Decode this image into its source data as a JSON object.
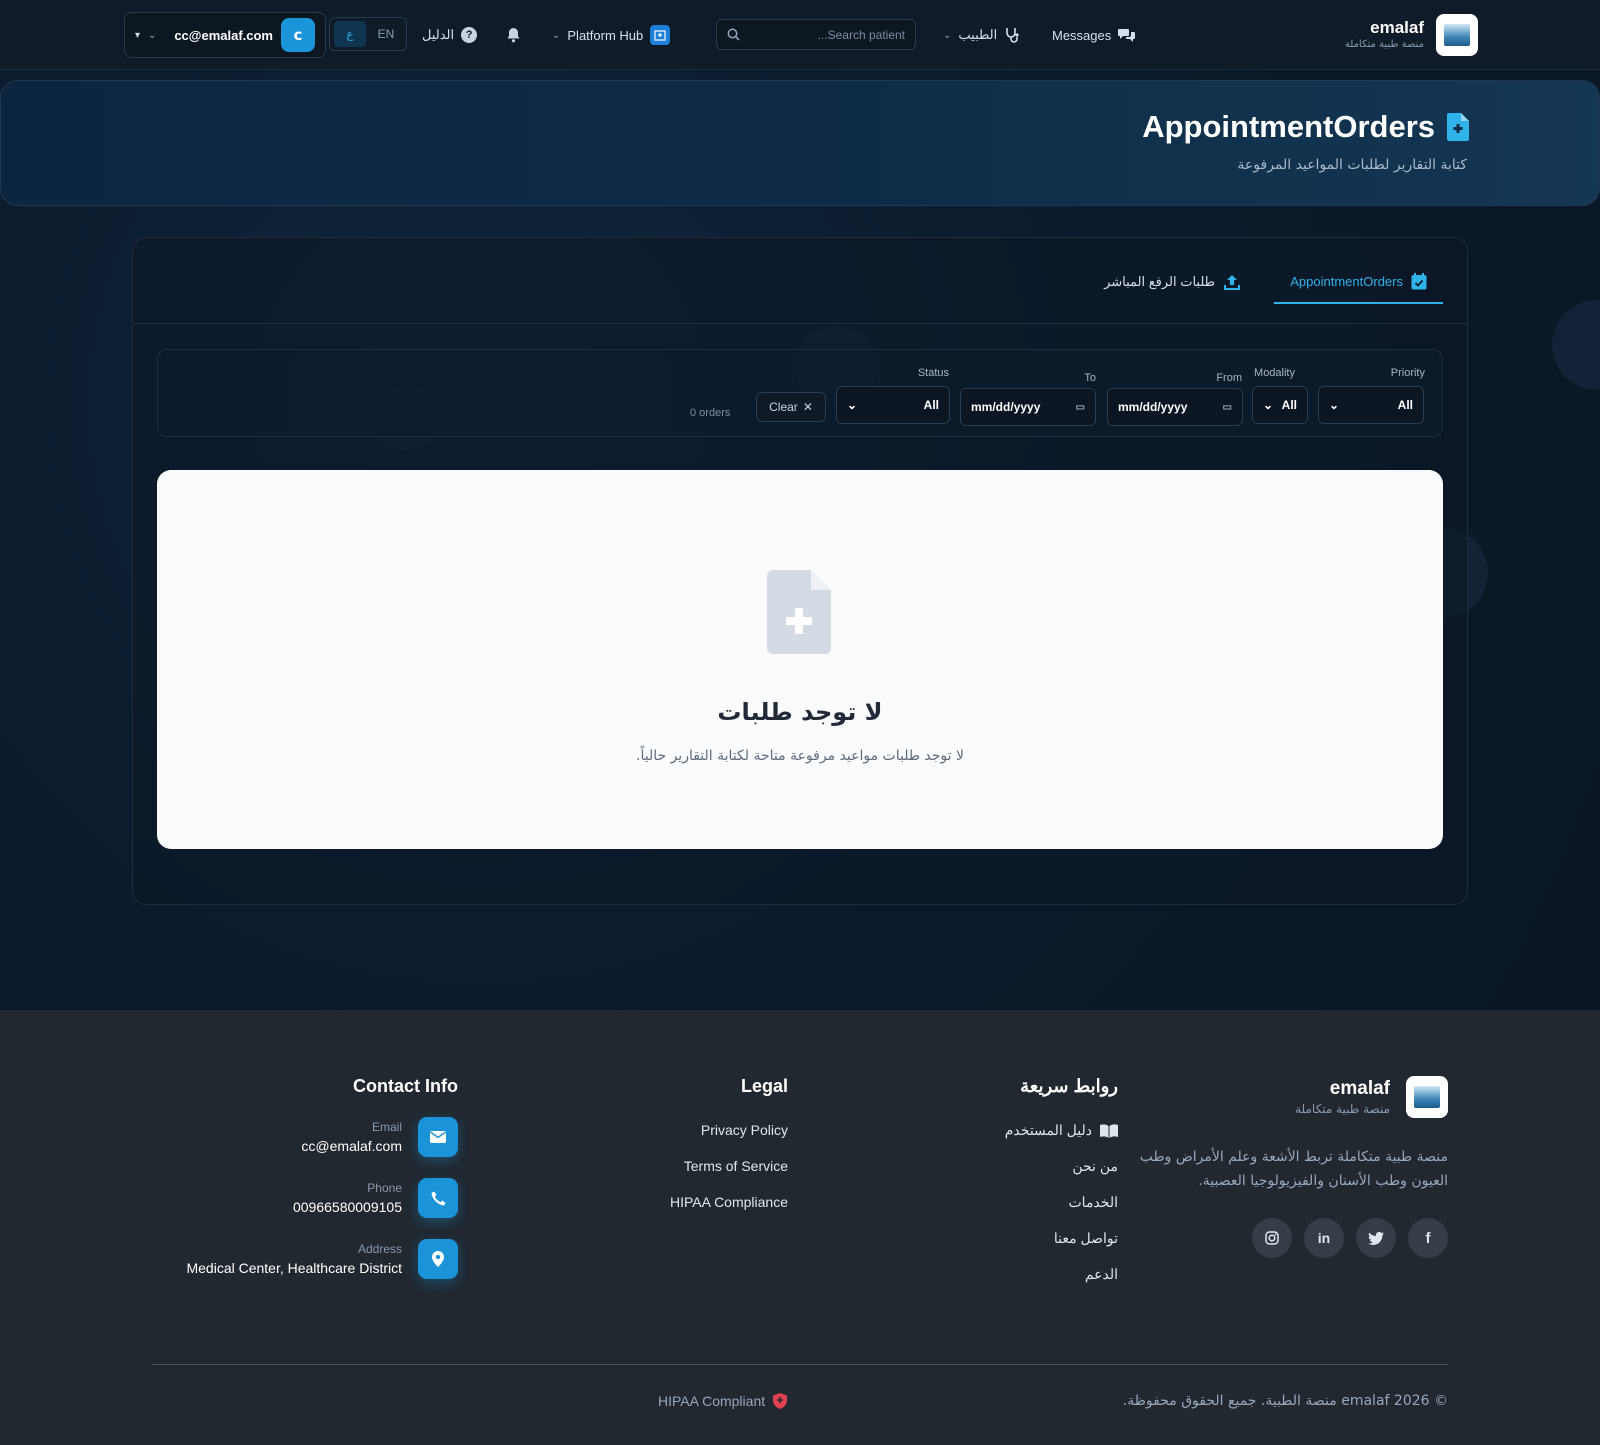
{
  "brand": {
    "name": "emalaf",
    "tagline": "منصة طبية متكاملة"
  },
  "navbar": {
    "messages_label": "Messages",
    "doctor_label": "الطبيب",
    "search_placeholder": "Search patient...",
    "platform_hub_label": "Platform Hub",
    "guide_label": "الدليل",
    "lang": {
      "en": "EN",
      "ar": "ع"
    },
    "user_email": "cc@emalaf.com",
    "user_initial": "c"
  },
  "hero": {
    "title": "AppointmentOrders",
    "subtitle": "كتابة التقارير لطلبات المواعيد المرفوعة"
  },
  "tabs": [
    {
      "label": "AppointmentOrders",
      "active": true
    },
    {
      "label": "طلبات الرفع المباشر",
      "active": false
    }
  ],
  "filters": {
    "priority": {
      "label": "Priority",
      "value": "All"
    },
    "modality": {
      "label": "Modality",
      "value": "All"
    },
    "from": {
      "label": "From",
      "value": "mm/dd/yyyy"
    },
    "to": {
      "label": "To",
      "value": "mm/dd/yyyy"
    },
    "status": {
      "label": "Status",
      "value": "All"
    },
    "clear_label": "Clear",
    "orders_count": "0 orders"
  },
  "empty_state": {
    "title": "لا توجد طلبات",
    "subtitle": "لا توجد طلبات مواعيد مرفوعة متاحة لكتابة التقارير حالياً."
  },
  "footer": {
    "description": "منصة طبية متكاملة تربط الأشعة وعلم الأمراض وطب العيون وطب الأسنان والفيزيولوجيا العصبية.",
    "quick_links": {
      "title": "روابط سريعة",
      "items": [
        "دليل المستخدم",
        "من نحن",
        "الخدمات",
        "تواصل معنا",
        "الدعم"
      ]
    },
    "legal": {
      "title": "Legal",
      "items": [
        "Privacy Policy",
        "Terms of Service",
        "HIPAA Compliance"
      ]
    },
    "contact": {
      "title": "Contact Info",
      "email_label": "Email",
      "email": "cc@emalaf.com",
      "phone_label": "Phone",
      "phone": "00966580009105",
      "address_label": "Address",
      "address": "Medical Center, Healthcare District"
    },
    "copyright": "© 2026 emalaf منصة الطبية. جميع الحقوق محفوظة.",
    "hipaa": "HIPAA Compliant"
  },
  "colors": {
    "accent": "#2fb3ea",
    "primary_button": "#1a93d8",
    "hipaa_shield": "#e0414f"
  }
}
